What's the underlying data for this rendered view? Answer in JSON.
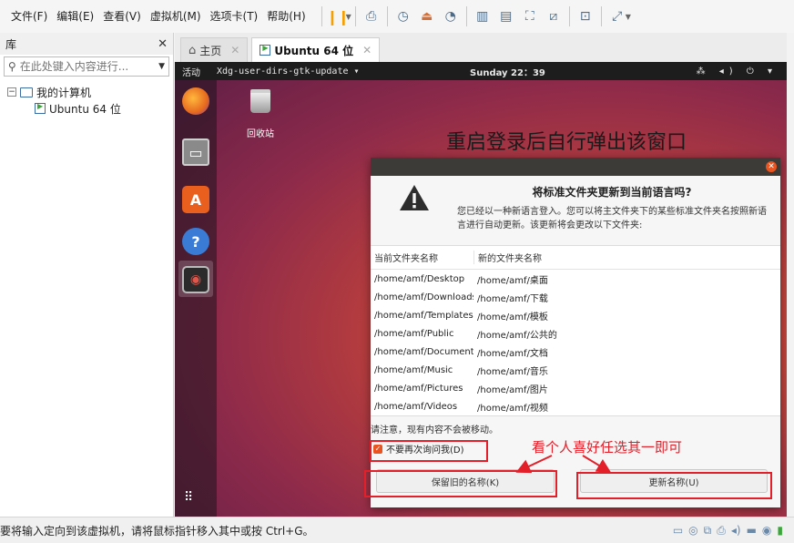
{
  "menubar": {
    "items": [
      "文件(F)",
      "编辑(E)",
      "查看(V)",
      "虚拟机(M)",
      "选项卡(T)",
      "帮助(H)"
    ],
    "toolbar_icons": [
      "pause-icon",
      "send-keys-icon",
      "snapshot-icon",
      "revert-snapshot-icon",
      "snapshot-manager-icon",
      "library-view-icon",
      "thumbnail-view-icon",
      "fullscreen-icon",
      "unity-icon",
      "console-icon",
      "stretch-icon"
    ]
  },
  "library": {
    "title": "库",
    "search_placeholder": "在此处键入内容进行...",
    "tree": {
      "root": "我的计算机",
      "child": "Ubuntu 64 位"
    }
  },
  "tabs": [
    {
      "label": "主页",
      "icon": "home-icon",
      "active": false
    },
    {
      "label": "Ubuntu 64 位",
      "icon": "vm-icon",
      "active": true
    }
  ],
  "ubuntu": {
    "activities": "活动",
    "app_menu": "Xdg-user-dirs-gtk-update ▾",
    "clock": "Sunday 22：39",
    "tray": "⁂ ◂) ⏻ ▾",
    "trash_label": "回收站"
  },
  "annotations": {
    "top": "重启登录后自行弹出该窗口",
    "bottom": "看个人喜好任选其一即可",
    "accent_color": "#e3202a"
  },
  "dialog": {
    "heading": "将标准文件夹更新到当前语言吗?",
    "description": "您已经以一种新语言登入。您可以将主文件夹下的某些标准文件夹名按照新语言进行自动更新。该更新将会更改以下文件夹:",
    "table": {
      "headers": [
        "当前文件夹名称",
        "新的文件夹名称"
      ],
      "rows": [
        [
          "/home/amf/Desktop",
          "/home/amf/桌面"
        ],
        [
          "/home/amf/Downloads",
          "/home/amf/下载"
        ],
        [
          "/home/amf/Templates",
          "/home/amf/模板"
        ],
        [
          "/home/amf/Public",
          "/home/amf/公共的"
        ],
        [
          "/home/amf/Documents",
          "/home/amf/文档"
        ],
        [
          "/home/amf/Music",
          "/home/amf/音乐"
        ],
        [
          "/home/amf/Pictures",
          "/home/amf/图片"
        ],
        [
          "/home/amf/Videos",
          "/home/amf/视频"
        ]
      ]
    },
    "note": "请注意，现有内容不会被移动。",
    "checkbox_label": "不要再次询问我(D)",
    "checkbox_checked": true,
    "keep_button": "保留旧的名称(K)",
    "update_button": "更新名称(U)",
    "accent_color": "#e95420"
  },
  "statusbar": {
    "text": "要将输入定向到该虚拟机，请将鼠标指针移入其中或按 Ctrl+G。"
  }
}
